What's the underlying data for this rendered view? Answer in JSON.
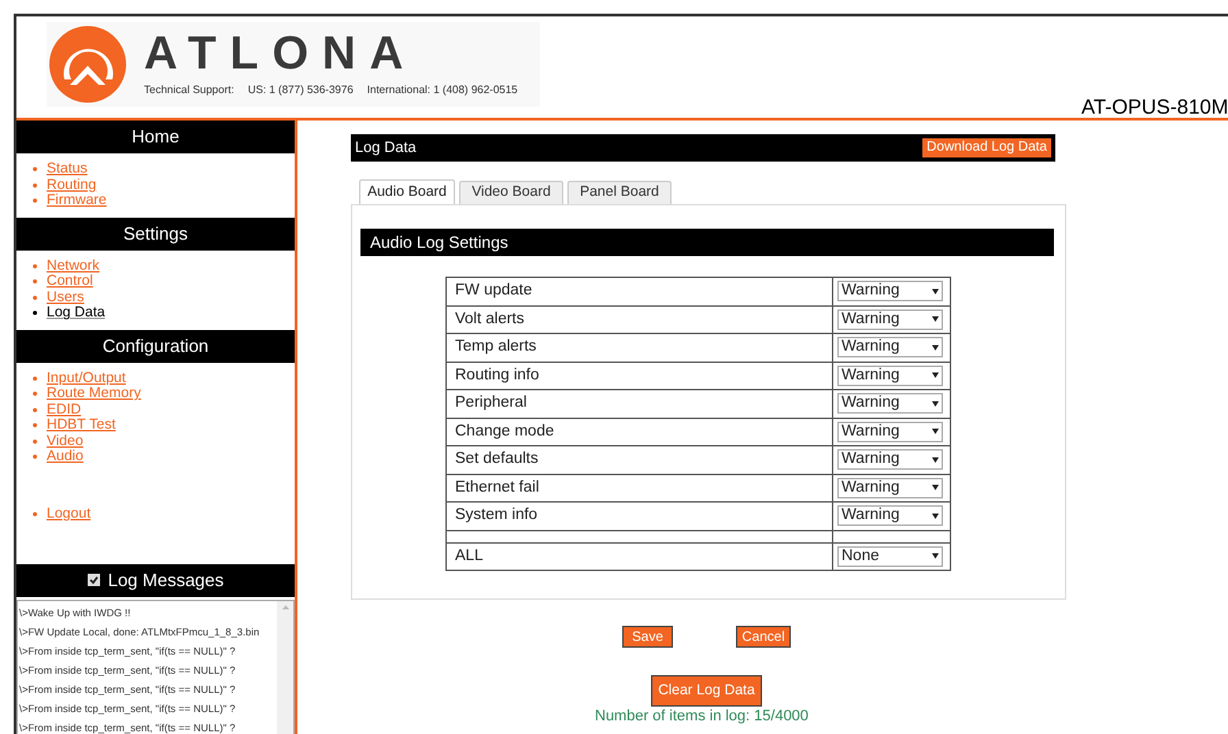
{
  "header": {
    "logo_text": "ATLONA",
    "support_label": "Technical Support:",
    "us_phone": "US: 1 (877) 536-3976",
    "intl_phone": "International: 1 (408) 962-0515",
    "model": "AT-OPUS-810M"
  },
  "sidebar": {
    "sections": [
      {
        "title": "Home",
        "items": [
          {
            "label": "Status",
            "selected": false
          },
          {
            "label": "Routing",
            "selected": false
          },
          {
            "label": "Firmware",
            "selected": false
          }
        ]
      },
      {
        "title": "Settings",
        "items": [
          {
            "label": "Network",
            "selected": false
          },
          {
            "label": "Control",
            "selected": false
          },
          {
            "label": "Users",
            "selected": false
          },
          {
            "label": "Log Data",
            "selected": true
          }
        ]
      },
      {
        "title": "Configuration",
        "items": [
          {
            "label": "Input/Output",
            "selected": false
          },
          {
            "label": "Route Memory",
            "selected": false
          },
          {
            "label": "EDID",
            "selected": false
          },
          {
            "label": "HDBT Test",
            "selected": false
          },
          {
            "label": "Video",
            "selected": false
          },
          {
            "label": "Audio",
            "selected": false
          }
        ]
      }
    ],
    "logout": "Logout",
    "log_messages": {
      "title": "Log Messages",
      "checked": true,
      "lines": [
        "\\>Wake Up with IWDG !!",
        "\\>FW Update Local, done: ATLMtxFPmcu_1_8_3.bin",
        "\\>From inside tcp_term_sent, \"if(ts == NULL)\" ?",
        "\\>From inside tcp_term_sent, \"if(ts == NULL)\" ?",
        "\\>From inside tcp_term_sent, \"if(ts == NULL)\" ?",
        "\\>From inside tcp_term_sent, \"if(ts == NULL)\" ?",
        "\\>From inside tcp_term_sent, \"if(ts == NULL)\" ?"
      ]
    }
  },
  "main": {
    "title": "Log Data",
    "download_button": "Download Log Data",
    "tabs": [
      {
        "label": "Audio Board",
        "selected": true
      },
      {
        "label": "Video Board",
        "selected": false
      },
      {
        "label": "Panel Board",
        "selected": false
      }
    ],
    "settings_title": "Audio Log Settings",
    "settings": [
      {
        "kind": "select",
        "label": "FW update",
        "value": "Warning"
      },
      {
        "kind": "select",
        "label": "Volt alerts",
        "value": "Warning"
      },
      {
        "kind": "select",
        "label": "Temp alerts",
        "value": "Warning"
      },
      {
        "kind": "select",
        "label": "Routing info",
        "value": "Warning"
      },
      {
        "kind": "select",
        "label": "Peripheral",
        "value": "Warning"
      },
      {
        "kind": "select",
        "label": "Change mode",
        "value": "Warning"
      },
      {
        "kind": "select",
        "label": "Set defaults",
        "value": "Warning"
      },
      {
        "kind": "select",
        "label": "Ethernet fail",
        "value": "Warning"
      },
      {
        "kind": "select",
        "label": "System info",
        "value": "Warning"
      },
      {
        "kind": "spacer"
      },
      {
        "kind": "select",
        "label": "ALL",
        "value": "None"
      }
    ],
    "save_button": "Save",
    "cancel_button": "Cancel",
    "clear_button": "Clear Log Data",
    "count_text": "Number of items in log: 15/4000"
  }
}
